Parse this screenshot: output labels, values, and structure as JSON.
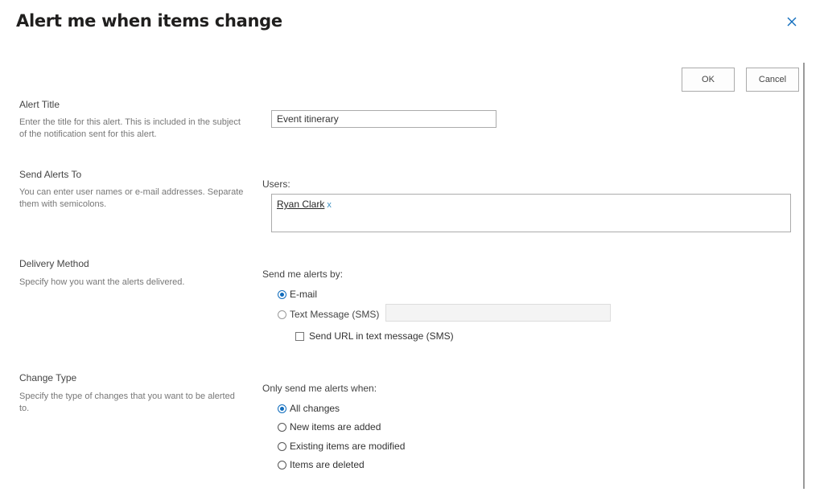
{
  "dialog": {
    "title": "Alert me when items change",
    "close_icon": "close-icon"
  },
  "buttons": {
    "ok_label": "OK",
    "cancel_label": "Cancel"
  },
  "alert_title": {
    "heading": "Alert Title",
    "description": "Enter the title for this alert. This is included in the subject of the notification sent for this alert.",
    "value": "Event itinerary"
  },
  "send_to": {
    "heading": "Send Alerts To",
    "description": "You can enter user names or e-mail addresses. Separate them with semicolons.",
    "users_label": "Users:",
    "users": [
      {
        "name": "Ryan Clark",
        "remove": "x"
      }
    ]
  },
  "delivery": {
    "heading": "Delivery Method",
    "description": "Specify how you want the alerts delivered.",
    "prompt": "Send me alerts by:",
    "options": [
      {
        "label": "E-mail",
        "selected": true
      },
      {
        "label": "Text Message (SMS)",
        "selected": false,
        "disabled": true
      }
    ],
    "sms_number": "",
    "send_url_label": "Send URL in text message (SMS)",
    "send_url_checked": false
  },
  "change_type": {
    "heading": "Change Type",
    "description": "Specify the type of changes that you want to be alerted to.",
    "prompt": "Only send me alerts when:",
    "options": [
      {
        "label": "All changes",
        "selected": true
      },
      {
        "label": "New items are added",
        "selected": false
      },
      {
        "label": "Existing items are modified",
        "selected": false
      },
      {
        "label": "Items are deleted",
        "selected": false
      }
    ]
  },
  "colors": {
    "accent": "#0f6cbd",
    "border": "#ababab",
    "muted_text": "#777777"
  }
}
